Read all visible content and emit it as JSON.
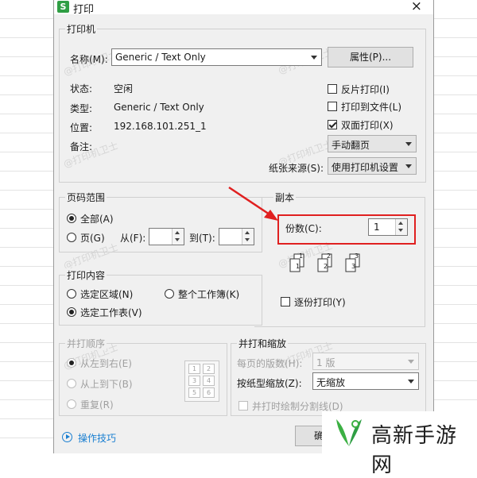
{
  "window": {
    "app_icon": "S",
    "title": "打印",
    "close": "×"
  },
  "printer": {
    "group_title": "打印机",
    "name_label": "名称(M):",
    "name_value": "Generic / Text Only",
    "properties_button": "属性(P)...",
    "status_label": "状态:",
    "status_value": "空闲",
    "type_label": "类型:",
    "type_value": "Generic / Text Only",
    "location_label": "位置:",
    "location_value": "192.168.101.251_1",
    "comment_label": "备注:",
    "reverse_print": {
      "label": "反片打印(I)",
      "checked": false
    },
    "print_to_file": {
      "label": "打印到文件(L)",
      "checked": false
    },
    "duplex": {
      "label": "双面打印(X)",
      "checked": true
    },
    "duplex_mode": "手动翻页",
    "paper_source_label": "纸张来源(S):",
    "paper_source_value": "使用打印机设置"
  },
  "page_range": {
    "group_title": "页码范围",
    "all_label": "全部(A)",
    "pages_label": "页(G)",
    "from_label": "从(F):",
    "to_label": "到(T):",
    "from_value": "",
    "to_value": ""
  },
  "copies": {
    "group_title": "副本",
    "count_label": "份数(C):",
    "count_value": "1",
    "page_labels": [
      "1",
      "1",
      "2",
      "2",
      "3",
      "3"
    ],
    "collate_label": "逐份打印(Y)"
  },
  "print_what": {
    "group_title": "打印内容",
    "selection_label": "选定区域(N)",
    "workbook_label": "整个工作簿(K)",
    "sheet_label": "选定工作表(V)"
  },
  "print_order": {
    "group_title": "并打顺序",
    "left_right_label": "从左到右(E)",
    "top_bottom_label": "从上到下(B)",
    "repeat_label": "重复(R)",
    "layout_cells": [
      "1",
      "2",
      "3",
      "4",
      "5",
      "6"
    ]
  },
  "zoom": {
    "group_title": "并打和缩放",
    "pages_per_sheet_label": "每页的版数(H):",
    "pages_per_sheet_value": "1 版",
    "scale_label": "按纸型缩放(Z):",
    "scale_value": "无缩放",
    "draw_borders_label": "并打时绘制分割线(D)"
  },
  "footer": {
    "tips_link": "操作技巧",
    "ok_button_partial": "确"
  },
  "watermark_text": "@打印机卫士",
  "logo": {
    "text": "高新手游网"
  },
  "colors": {
    "highlight_red": "#e02020",
    "logo_green": "#3cb043",
    "help_blue": "#1a7fd1"
  }
}
